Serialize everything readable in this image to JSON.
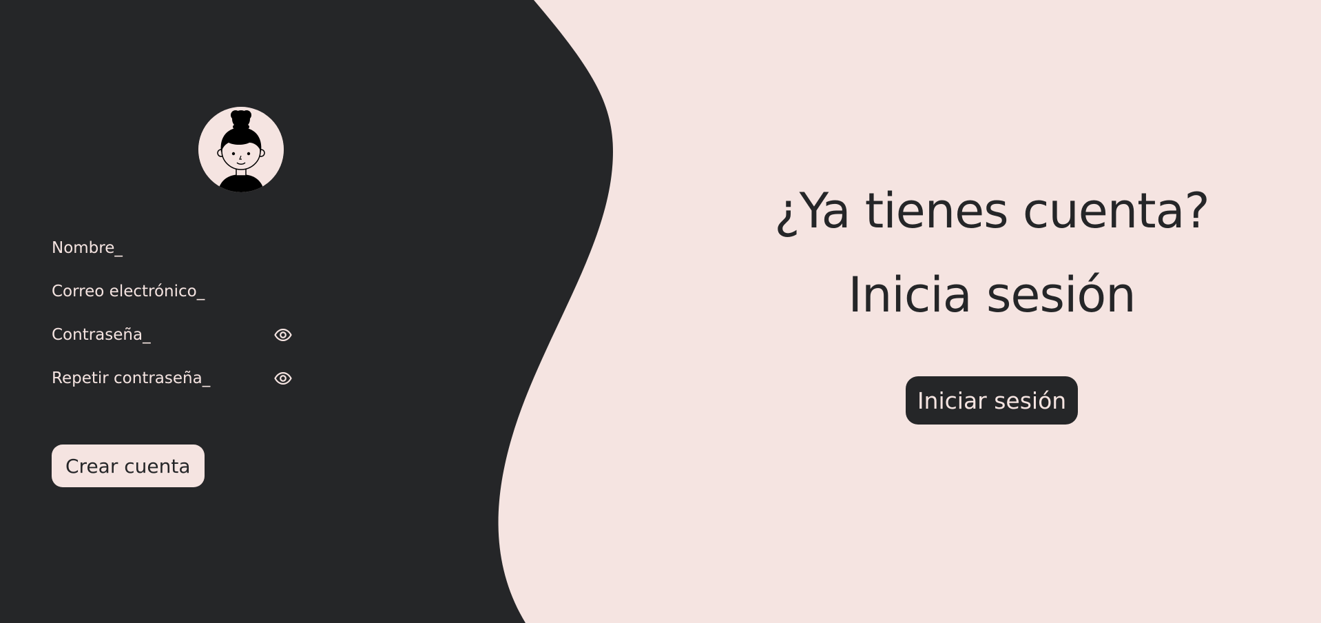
{
  "colors": {
    "dark": "#252628",
    "light": "#f5e4e1"
  },
  "register": {
    "avatar_icon": "woman-avatar-icon",
    "fields": {
      "name_placeholder": "Nombre_",
      "email_placeholder": "Correo electrónico_",
      "password_placeholder": "Contraseña_",
      "repeat_password_placeholder": "Repetir contraseña_"
    },
    "show_password_icon": "eye-icon",
    "submit_label": "Crear cuenta"
  },
  "login_prompt": {
    "question": "¿Ya tienes cuenta?",
    "subtitle": "Inicia sesión",
    "button_label": "Iniciar sesión"
  }
}
